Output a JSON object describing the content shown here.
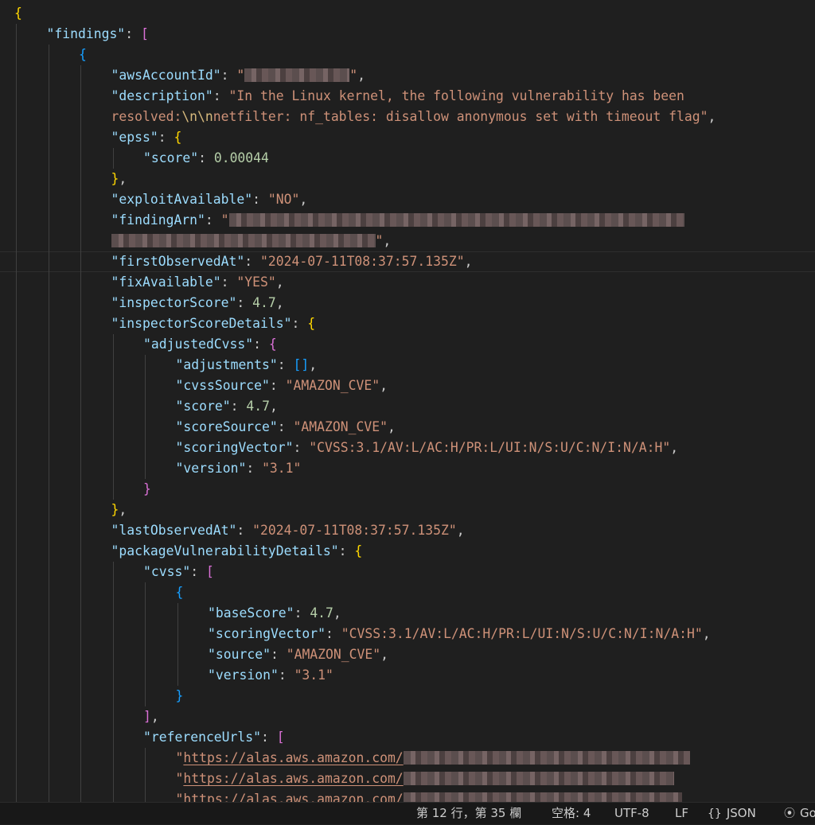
{
  "colors": {
    "background": "#1f1f1f",
    "key": "#9cdcfe",
    "string": "#ce9178",
    "number": "#b5cea8",
    "bracket_level1": "#ffd700",
    "bracket_level2": "#da70d6",
    "bracket_level3": "#179fff"
  },
  "editor": {
    "language": "json",
    "current_line_index": 12,
    "lines": [
      {
        "indent": 0,
        "tokens": [
          {
            "t": "{",
            "c": "b1"
          }
        ]
      },
      {
        "indent": 1,
        "tokens": [
          {
            "t": "\"findings\"",
            "c": "k"
          },
          {
            "t": ": ",
            "c": "p"
          },
          {
            "t": "[",
            "c": "b2"
          }
        ]
      },
      {
        "indent": 2,
        "tokens": [
          {
            "t": "{",
            "c": "b3"
          }
        ]
      },
      {
        "indent": 3,
        "tokens": [
          {
            "t": "\"awsAccountId\"",
            "c": "k"
          },
          {
            "t": ": ",
            "c": "p"
          },
          {
            "t": "\"",
            "c": "s"
          },
          {
            "t": "",
            "c": "redact",
            "w": 132
          },
          {
            "t": "\"",
            "c": "s"
          },
          {
            "t": ",",
            "c": "p"
          }
        ]
      },
      {
        "indent": 3,
        "tokens": [
          {
            "t": "\"description\"",
            "c": "k"
          },
          {
            "t": ": ",
            "c": "p"
          },
          {
            "t": "\"In the Linux kernel, the following vulnerability has been",
            "c": "s"
          }
        ]
      },
      {
        "indent": 3,
        "tokens": [
          {
            "t": "resolved:",
            "c": "s"
          },
          {
            "t": "\\n\\n",
            "c": "e"
          },
          {
            "t": "netfilter: nf_tables: disallow anonymous set with timeout flag\"",
            "c": "s"
          },
          {
            "t": ",",
            "c": "p"
          }
        ]
      },
      {
        "indent": 3,
        "tokens": [
          {
            "t": "\"epss\"",
            "c": "k"
          },
          {
            "t": ": ",
            "c": "p"
          },
          {
            "t": "{",
            "c": "b1"
          }
        ]
      },
      {
        "indent": 4,
        "tokens": [
          {
            "t": "\"score\"",
            "c": "k"
          },
          {
            "t": ": ",
            "c": "p"
          },
          {
            "t": "0.00044",
            "c": "n"
          }
        ]
      },
      {
        "indent": 3,
        "tokens": [
          {
            "t": "}",
            "c": "b1"
          },
          {
            "t": ",",
            "c": "p"
          }
        ]
      },
      {
        "indent": 3,
        "tokens": [
          {
            "t": "\"exploitAvailable\"",
            "c": "k"
          },
          {
            "t": ": ",
            "c": "p"
          },
          {
            "t": "\"NO\"",
            "c": "s"
          },
          {
            "t": ",",
            "c": "p"
          }
        ]
      },
      {
        "indent": 3,
        "tokens": [
          {
            "t": "\"findingArn\"",
            "c": "k"
          },
          {
            "t": ": ",
            "c": "p"
          },
          {
            "t": "\"",
            "c": "s"
          },
          {
            "t": "",
            "c": "redact",
            "w": 572
          }
        ]
      },
      {
        "indent": 3,
        "tokens": [
          {
            "t": "",
            "c": "redact",
            "w": 332
          },
          {
            "t": "\"",
            "c": "s"
          },
          {
            "t": ",",
            "c": "p"
          }
        ]
      },
      {
        "indent": 3,
        "tokens": [
          {
            "t": "\"firstObservedAt\"",
            "c": "k"
          },
          {
            "t": ": ",
            "c": "p"
          },
          {
            "t": "\"2024-07-11T08:37:57.135Z\"",
            "c": "s"
          },
          {
            "t": ",",
            "c": "p"
          }
        ]
      },
      {
        "indent": 3,
        "tokens": [
          {
            "t": "\"fixAvailable\"",
            "c": "k"
          },
          {
            "t": ": ",
            "c": "p"
          },
          {
            "t": "\"YES\"",
            "c": "s"
          },
          {
            "t": ",",
            "c": "p"
          }
        ]
      },
      {
        "indent": 3,
        "tokens": [
          {
            "t": "\"inspectorScore\"",
            "c": "k"
          },
          {
            "t": ": ",
            "c": "p"
          },
          {
            "t": "4.7",
            "c": "n"
          },
          {
            "t": ",",
            "c": "p"
          }
        ]
      },
      {
        "indent": 3,
        "tokens": [
          {
            "t": "\"inspectorScoreDetails\"",
            "c": "k"
          },
          {
            "t": ": ",
            "c": "p"
          },
          {
            "t": "{",
            "c": "b1"
          }
        ]
      },
      {
        "indent": 4,
        "tokens": [
          {
            "t": "\"adjustedCvss\"",
            "c": "k"
          },
          {
            "t": ": ",
            "c": "p"
          },
          {
            "t": "{",
            "c": "b2"
          }
        ]
      },
      {
        "indent": 5,
        "tokens": [
          {
            "t": "\"adjustments\"",
            "c": "k"
          },
          {
            "t": ": ",
            "c": "p"
          },
          {
            "t": "[]",
            "c": "b3"
          },
          {
            "t": ",",
            "c": "p"
          }
        ]
      },
      {
        "indent": 5,
        "tokens": [
          {
            "t": "\"cvssSource\"",
            "c": "k"
          },
          {
            "t": ": ",
            "c": "p"
          },
          {
            "t": "\"AMAZON_CVE\"",
            "c": "s"
          },
          {
            "t": ",",
            "c": "p"
          }
        ]
      },
      {
        "indent": 5,
        "tokens": [
          {
            "t": "\"score\"",
            "c": "k"
          },
          {
            "t": ": ",
            "c": "p"
          },
          {
            "t": "4.7",
            "c": "n"
          },
          {
            "t": ",",
            "c": "p"
          }
        ]
      },
      {
        "indent": 5,
        "tokens": [
          {
            "t": "\"scoreSource\"",
            "c": "k"
          },
          {
            "t": ": ",
            "c": "p"
          },
          {
            "t": "\"AMAZON_CVE\"",
            "c": "s"
          },
          {
            "t": ",",
            "c": "p"
          }
        ]
      },
      {
        "indent": 5,
        "tokens": [
          {
            "t": "\"scoringVector\"",
            "c": "k"
          },
          {
            "t": ": ",
            "c": "p"
          },
          {
            "t": "\"CVSS:3.1/AV:L/AC:H/PR:L/UI:N/S:U/C:N/I:N/A:H\"",
            "c": "s"
          },
          {
            "t": ",",
            "c": "p"
          }
        ]
      },
      {
        "indent": 5,
        "tokens": [
          {
            "t": "\"version\"",
            "c": "k"
          },
          {
            "t": ": ",
            "c": "p"
          },
          {
            "t": "\"3.1\"",
            "c": "s"
          }
        ]
      },
      {
        "indent": 4,
        "tokens": [
          {
            "t": "}",
            "c": "b2"
          }
        ]
      },
      {
        "indent": 3,
        "tokens": [
          {
            "t": "}",
            "c": "b1"
          },
          {
            "t": ",",
            "c": "p"
          }
        ]
      },
      {
        "indent": 3,
        "tokens": [
          {
            "t": "\"lastObservedAt\"",
            "c": "k"
          },
          {
            "t": ": ",
            "c": "p"
          },
          {
            "t": "\"2024-07-11T08:37:57.135Z\"",
            "c": "s"
          },
          {
            "t": ",",
            "c": "p"
          }
        ]
      },
      {
        "indent": 3,
        "tokens": [
          {
            "t": "\"packageVulnerabilityDetails\"",
            "c": "k"
          },
          {
            "t": ": ",
            "c": "p"
          },
          {
            "t": "{",
            "c": "b1"
          }
        ]
      },
      {
        "indent": 4,
        "tokens": [
          {
            "t": "\"cvss\"",
            "c": "k"
          },
          {
            "t": ": ",
            "c": "p"
          },
          {
            "t": "[",
            "c": "b2"
          }
        ]
      },
      {
        "indent": 5,
        "tokens": [
          {
            "t": "{",
            "c": "b3"
          }
        ]
      },
      {
        "indent": 6,
        "tokens": [
          {
            "t": "\"baseScore\"",
            "c": "k"
          },
          {
            "t": ": ",
            "c": "p"
          },
          {
            "t": "4.7",
            "c": "n"
          },
          {
            "t": ",",
            "c": "p"
          }
        ]
      },
      {
        "indent": 6,
        "tokens": [
          {
            "t": "\"scoringVector\"",
            "c": "k"
          },
          {
            "t": ": ",
            "c": "p"
          },
          {
            "t": "\"CVSS:3.1/AV:L/AC:H/PR:L/UI:N/S:U/C:N/I:N/A:H\"",
            "c": "s"
          },
          {
            "t": ",",
            "c": "p"
          }
        ]
      },
      {
        "indent": 6,
        "tokens": [
          {
            "t": "\"source\"",
            "c": "k"
          },
          {
            "t": ": ",
            "c": "p"
          },
          {
            "t": "\"AMAZON_CVE\"",
            "c": "s"
          },
          {
            "t": ",",
            "c": "p"
          }
        ]
      },
      {
        "indent": 6,
        "tokens": [
          {
            "t": "\"version\"",
            "c": "k"
          },
          {
            "t": ": ",
            "c": "p"
          },
          {
            "t": "\"3.1\"",
            "c": "s"
          }
        ]
      },
      {
        "indent": 5,
        "tokens": [
          {
            "t": "}",
            "c": "b3"
          }
        ]
      },
      {
        "indent": 4,
        "tokens": [
          {
            "t": "]",
            "c": "b2"
          },
          {
            "t": ",",
            "c": "p"
          }
        ]
      },
      {
        "indent": 4,
        "tokens": [
          {
            "t": "\"referenceUrls\"",
            "c": "k"
          },
          {
            "t": ": ",
            "c": "p"
          },
          {
            "t": "[",
            "c": "b2"
          }
        ]
      },
      {
        "indent": 5,
        "tokens": [
          {
            "t": "\"",
            "c": "s"
          },
          {
            "t": "https://alas.aws.amazon.com/",
            "c": "s u"
          },
          {
            "t": "",
            "c": "redact",
            "w": 360
          }
        ]
      },
      {
        "indent": 5,
        "tokens": [
          {
            "t": "\"",
            "c": "s"
          },
          {
            "t": "https://alas.aws.amazon.com/",
            "c": "s u"
          },
          {
            "t": "",
            "c": "redact",
            "w": 340
          }
        ]
      },
      {
        "indent": 5,
        "tokens": [
          {
            "t": "\"",
            "c": "s"
          },
          {
            "t": "https://alas.aws.amazon.com/",
            "c": "s u"
          },
          {
            "t": "",
            "c": "redact",
            "w": 350
          }
        ]
      }
    ]
  },
  "statusbar": {
    "position": "第 12 行，第 35 欄",
    "indent": "空格: 4",
    "encoding": "UTF-8",
    "eol": "LF",
    "language": "JSON",
    "language_icon": "braces-icon",
    "extra": "Go",
    "extra_icon": "broadcast-icon"
  }
}
